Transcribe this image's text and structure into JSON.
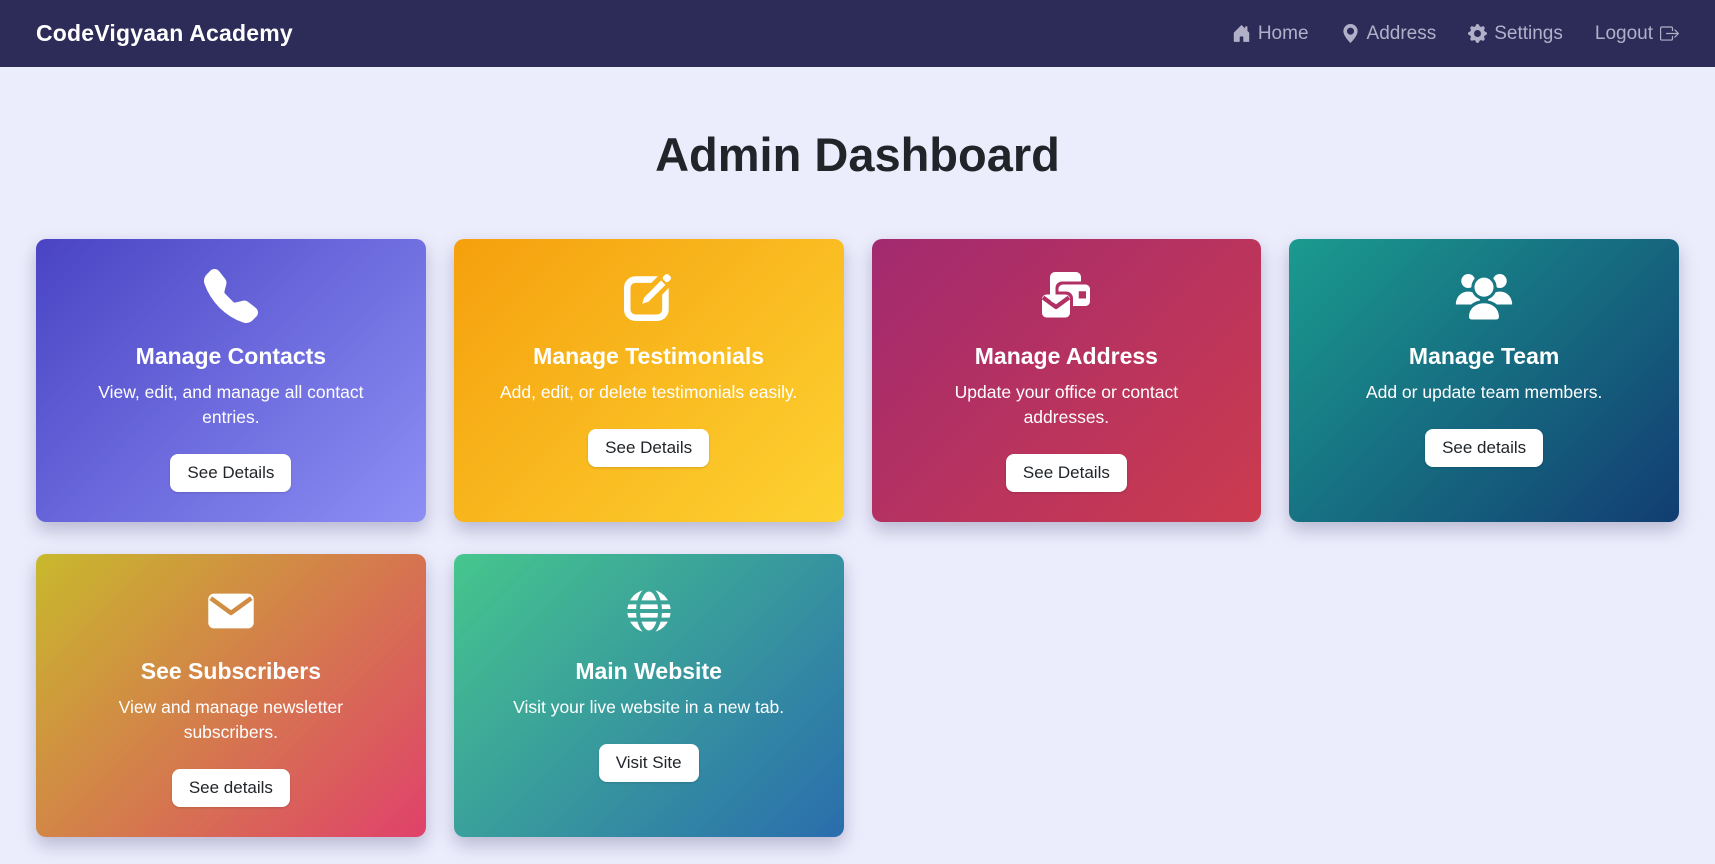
{
  "navbar": {
    "brand": "CodeVigyaan Academy",
    "items": [
      {
        "label": "Home",
        "icon": "home-icon"
      },
      {
        "label": "Address",
        "icon": "map-pin-icon"
      },
      {
        "label": "Settings",
        "icon": "gear-icon"
      },
      {
        "label": "Logout",
        "icon": "logout-icon"
      }
    ]
  },
  "page": {
    "title": "Admin Dashboard"
  },
  "cards": [
    {
      "title": "Manage Contacts",
      "description": "View, edit, and manage all contact entries.",
      "button": "See Details",
      "icon": "phone-icon",
      "gradient": [
        "#4a44c4",
        "#8d8ff5"
      ]
    },
    {
      "title": "Manage Testimonials",
      "description": "Add, edit, or delete testimonials easily.",
      "button": "See Details",
      "icon": "edit-icon",
      "gradient": [
        "#f5a00d",
        "#fdd231"
      ]
    },
    {
      "title": "Manage Address",
      "description": "Update your office or contact addresses.",
      "button": "See Details",
      "icon": "mail-stack-icon",
      "gradient": [
        "#a22a70",
        "#cc3b4e"
      ]
    },
    {
      "title": "Manage Team",
      "description": "Add or update team members.",
      "button": "See details",
      "icon": "team-icon",
      "gradient": [
        "#1a9b8f",
        "#123d72"
      ]
    },
    {
      "title": "See Subscribers",
      "description": "View and manage newsletter subscribers.",
      "button": "See details",
      "icon": "envelope-icon",
      "gradient": [
        "#c8b92c",
        "#e0416b"
      ]
    },
    {
      "title": "Main Website",
      "description": "Visit your live website in a new tab.",
      "button": "Visit Site",
      "icon": "globe-icon",
      "gradient": [
        "#46c68d",
        "#2a6dad"
      ]
    }
  ],
  "colors": {
    "navbar_bg": "#2d2b58",
    "page_bg": "#ecedfc",
    "nav_link": "#b2b0c9",
    "title_text": "#212529",
    "card_text": "#ffffff",
    "button_bg": "#ffffff",
    "button_text": "#212529"
  }
}
